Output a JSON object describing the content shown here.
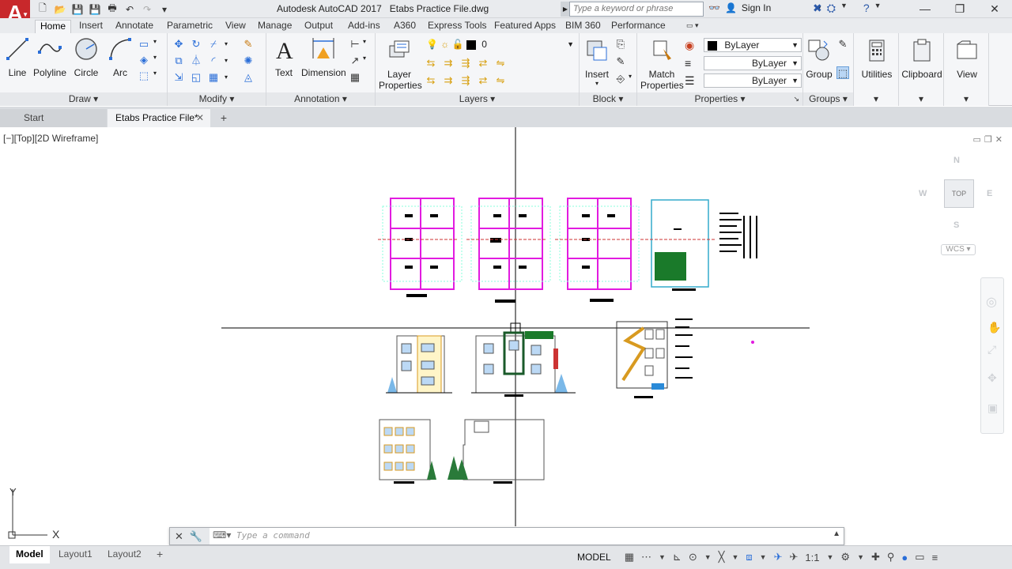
{
  "titlebar": {
    "app_title": "Autodesk AutoCAD 2017",
    "file_title": "Etabs Practice File.dwg",
    "logo_letter": "A",
    "search_placeholder": "Type a keyword or phrase",
    "signin_label": "Sign In"
  },
  "ribbon_tabs": [
    "Home",
    "Insert",
    "Annotate",
    "Parametric",
    "View",
    "Manage",
    "Output",
    "Add-ins",
    "A360",
    "Express Tools",
    "Featured Apps",
    "BIM 360",
    "Performance"
  ],
  "ribbon": {
    "draw": {
      "title": "Draw",
      "line": "Line",
      "polyline": "Polyline",
      "circle": "Circle",
      "arc": "Arc"
    },
    "modify": {
      "title": "Modify"
    },
    "annotation": {
      "title": "Annotation",
      "text": "Text",
      "dimension": "Dimension"
    },
    "layers": {
      "title": "Layers",
      "layer_properties_1": "Layer",
      "layer_properties_2": "Properties",
      "current_layer": "0"
    },
    "block": {
      "title": "Block",
      "insert": "Insert"
    },
    "properties": {
      "title": "Properties",
      "match_1": "Match",
      "match_2": "Properties",
      "color": "ByLayer",
      "linetype": "ByLayer",
      "lineweight": "ByLayer"
    },
    "groups": {
      "title": "Groups",
      "group": "Group"
    },
    "utilities": "Utilities",
    "clipboard": "Clipboard",
    "view": "View"
  },
  "file_tabs": {
    "start": "Start",
    "file": "Etabs Practice File*"
  },
  "viewport": {
    "label": "[−][Top][2D Wireframe]",
    "viewcube": {
      "top": "TOP",
      "n": "N",
      "s": "S",
      "e": "E",
      "w": "W",
      "wcs": "WCS"
    },
    "ucs_x": "X",
    "ucs_y": "Y"
  },
  "command": {
    "placeholder": "Type a command"
  },
  "status": {
    "model_tab": "Model",
    "layout1": "Layout1",
    "layout2": "Layout2",
    "space": "MODEL",
    "scale": "1:1"
  },
  "colors": {
    "accent": "#2a6ed8",
    "logo": "#c8282b",
    "magenta": "#e21be0",
    "green": "#1a7a2a"
  }
}
